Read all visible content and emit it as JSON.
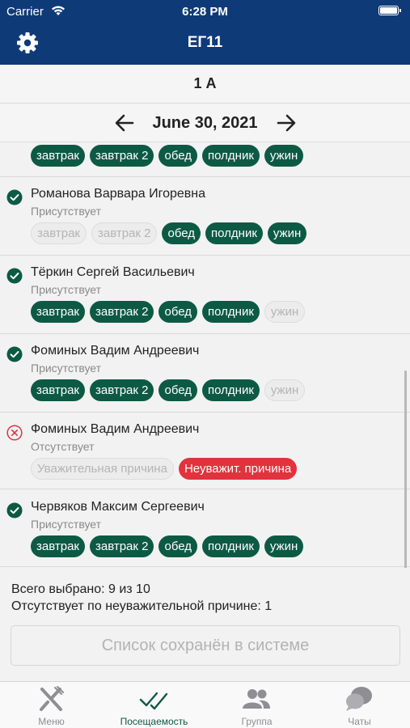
{
  "status_bar": {
    "carrier": "Carrier",
    "time": "6:28 PM"
  },
  "nav": {
    "title": "ЕГ11",
    "settings_icon": "gear-icon"
  },
  "group": {
    "name": "1 А"
  },
  "date": {
    "text": "June 30, 2021"
  },
  "partial_row": {
    "tags": [
      {
        "label": "завтрак",
        "on": true
      },
      {
        "label": "завтрак 2",
        "on": true
      },
      {
        "label": "обед",
        "on": true
      },
      {
        "label": "полдник",
        "on": true
      },
      {
        "label": "ужин",
        "on": true
      }
    ]
  },
  "students": [
    {
      "name": "Романова Варвара Игоревна",
      "status": "Присутствует",
      "present": true,
      "tags": [
        {
          "label": "завтрак",
          "on": false
        },
        {
          "label": "завтрак 2",
          "on": false
        },
        {
          "label": "обед",
          "on": true
        },
        {
          "label": "полдник",
          "on": true
        },
        {
          "label": "ужин",
          "on": true
        }
      ]
    },
    {
      "name": "Тёркин Сергей Васильевич",
      "status": "Присутствует",
      "present": true,
      "tags": [
        {
          "label": "завтрак",
          "on": true
        },
        {
          "label": "завтрак 2",
          "on": true
        },
        {
          "label": "обед",
          "on": true
        },
        {
          "label": "полдник",
          "on": true
        },
        {
          "label": "ужин",
          "on": false
        }
      ]
    },
    {
      "name": "Фоминых  Вадим Андреевич",
      "status": "Присутствует",
      "present": true,
      "tags": [
        {
          "label": "завтрак",
          "on": true
        },
        {
          "label": "завтрак 2",
          "on": true
        },
        {
          "label": "обед",
          "on": true
        },
        {
          "label": "полдник",
          "on": true
        },
        {
          "label": "ужин",
          "on": false
        }
      ]
    },
    {
      "name": "Фоминых Вадим Андреевич",
      "status": "Отсутствует",
      "present": false,
      "reasons": [
        {
          "label": "Уважительная причина",
          "selected": false
        },
        {
          "label": "Неуважит. причина",
          "selected": true
        }
      ]
    },
    {
      "name": "Червяков Максим Сергеевич",
      "status": "Присутствует",
      "present": true,
      "tags": [
        {
          "label": "завтрак",
          "on": true
        },
        {
          "label": "завтрак 2",
          "on": true
        },
        {
          "label": "обед",
          "on": true
        },
        {
          "label": "полдник",
          "on": true
        },
        {
          "label": "ужин",
          "on": true
        }
      ]
    }
  ],
  "summary": {
    "selected": "Всего выбрано: 9 из 10",
    "absent_unexcused": "Отсутствует по неуважительной причине: 1",
    "save_button": "Список сохранён в системе"
  },
  "tabs": [
    {
      "label": "Меню",
      "icon": "fork-knife-icon",
      "active": false
    },
    {
      "label": "Посещаемость",
      "icon": "checkmarks-icon",
      "active": true
    },
    {
      "label": "Группа",
      "icon": "group-icon",
      "active": false
    },
    {
      "label": "Чаты",
      "icon": "chat-icon",
      "active": false
    }
  ],
  "colors": {
    "nav_bg": "#0f3a78",
    "tag_on": "#0d5a44",
    "tag_unexcused": "#e0333e",
    "absent_icon": "#e0333e"
  }
}
